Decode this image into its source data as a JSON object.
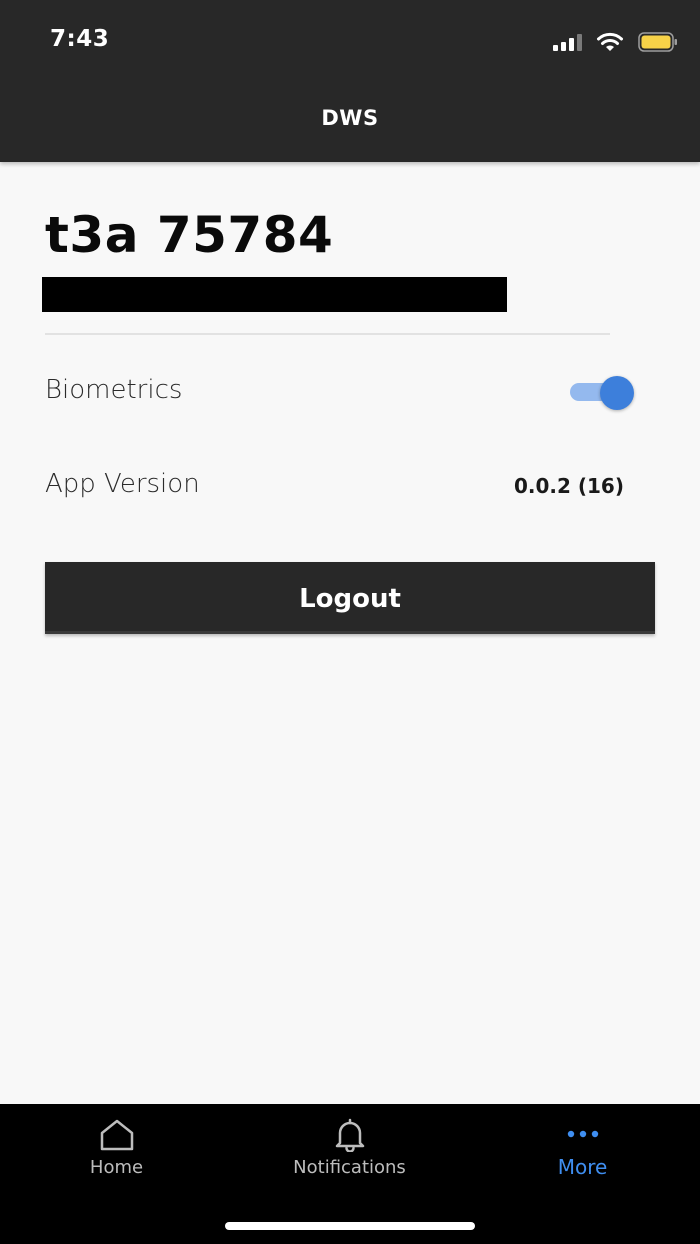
{
  "status_bar": {
    "time": "7:43"
  },
  "nav": {
    "title": "DWS"
  },
  "account": {
    "name": "t3a 75784"
  },
  "settings": {
    "biometrics_label": "Biometrics",
    "biometrics_enabled": true,
    "app_version_label": "App Version",
    "app_version_value": "0.0.2 (16)"
  },
  "actions": {
    "logout_label": "Logout"
  },
  "tabs": [
    {
      "label": "Home",
      "icon": "home-icon",
      "active": false
    },
    {
      "label": "Notifications",
      "icon": "bell-icon",
      "active": false
    },
    {
      "label": "More",
      "icon": "more-dots-icon",
      "active": true
    }
  ],
  "colors": {
    "header_bg": "#282828",
    "content_bg": "#f8f8f8",
    "accent_blue": "#3d7fdb",
    "toggle_track": "#94b9ee",
    "tab_active": "#3f8ef0",
    "tab_bar_bg": "#000000"
  }
}
